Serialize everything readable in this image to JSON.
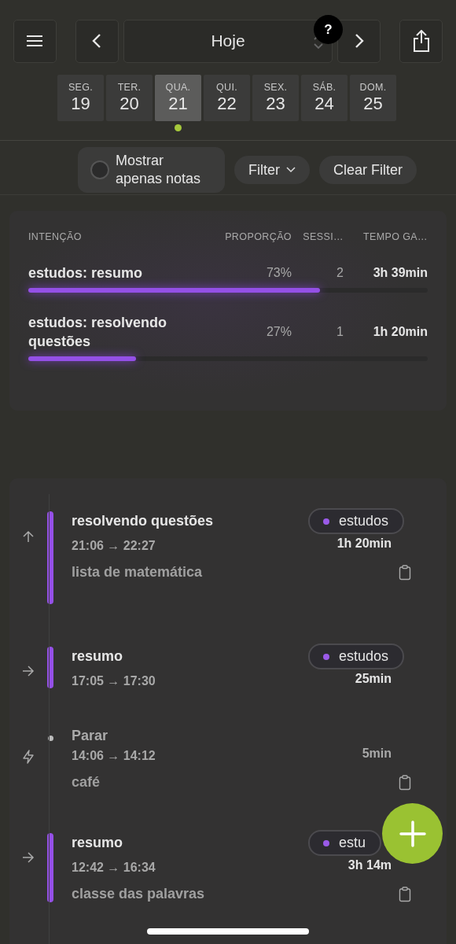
{
  "header": {
    "title": "Hoje",
    "help_badge": "?"
  },
  "days": [
    {
      "weekday": "SEG.",
      "day": "19",
      "selected": false,
      "has_dot": false
    },
    {
      "weekday": "TER.",
      "day": "20",
      "selected": false,
      "has_dot": false
    },
    {
      "weekday": "QUA.",
      "day": "21",
      "selected": true,
      "has_dot": true
    },
    {
      "weekday": "QUI.",
      "day": "22",
      "selected": false,
      "has_dot": false
    },
    {
      "weekday": "SEX.",
      "day": "23",
      "selected": false,
      "has_dot": false
    },
    {
      "weekday": "SÁB.",
      "day": "24",
      "selected": false,
      "has_dot": false
    },
    {
      "weekday": "DOM.",
      "day": "25",
      "selected": false,
      "has_dot": false
    }
  ],
  "filters": {
    "notes_only": {
      "label": "Mostrar apenas notas",
      "checked": false
    },
    "filter": "Filter",
    "clear": "Clear Filter"
  },
  "summary": {
    "columns": [
      "INTENÇÃO",
      "PROPORÇÃO",
      "SESSI…",
      "TEMPO GA…"
    ],
    "rows": [
      {
        "intention": "estudos: resumo",
        "share": "73%",
        "sessions": "2",
        "time": "3h 39min",
        "level": 0.73
      },
      {
        "intention": "estudos: resolvendo questões",
        "share": "27%",
        "sessions": "1",
        "time": "1h 20min",
        "level": 0.27
      }
    ]
  },
  "entries": [
    {
      "kind": "up",
      "title": "resolvendo questões",
      "range": "21:06 → 22:27",
      "tag": "estudos",
      "duration": "1h 20min",
      "note": "lista de matemática"
    },
    {
      "kind": "right",
      "title": "resumo",
      "range": "17:05 → 17:30",
      "tag": "estudos",
      "duration": "25min"
    },
    {
      "kind": "stop",
      "title": "Parar",
      "range": "14:06 → 14:12",
      "duration": "5min",
      "note": "café"
    },
    {
      "kind": "right",
      "title": "resumo",
      "range": "12:42 → 16:34",
      "tag": "estu",
      "duration": "3h 14m",
      "note": "classe das palavras"
    }
  ]
}
